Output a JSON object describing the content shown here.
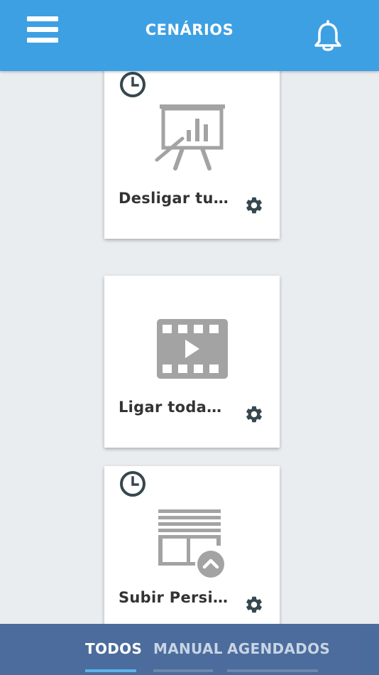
{
  "header": {
    "title": "CENÁRIOS",
    "menu_icon": "hamburger-menu-icon",
    "bell_icon": "bell-icon",
    "background_color": "#3da0e3"
  },
  "scenes": [
    {
      "label": "Desligar tu…",
      "scheduled": true,
      "icon": "presentation-board-icon"
    },
    {
      "label": "Ligar toda…",
      "scheduled": false,
      "icon": "video-play-icon"
    },
    {
      "label": "Subir Persi…",
      "scheduled": true,
      "icon": "blinds-up-icon"
    }
  ],
  "tabs": [
    {
      "label": "TODOS",
      "active": true
    },
    {
      "label": "MANUAL",
      "active": false
    },
    {
      "label": "AGENDADOS",
      "active": false
    }
  ],
  "colors": {
    "accent": "#3da0e3",
    "tab_bar": "#3e6296",
    "active_indicator": "#5fb1ea",
    "icon_gray": "#a3a3a3",
    "icon_dark": "#37474f",
    "page_background": "#eaedf0"
  }
}
